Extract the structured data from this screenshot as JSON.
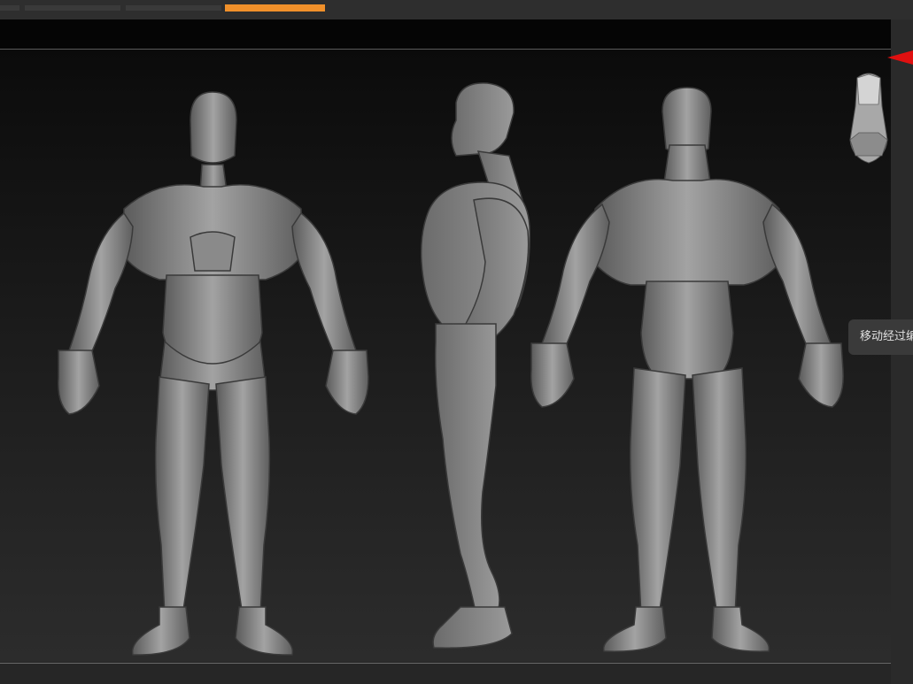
{
  "tooltip": {
    "text": "移动经过编"
  },
  "toolbar": {
    "active_color": "#f0902a"
  },
  "viewport": {
    "model_color": "#8a8a8a",
    "views": [
      "front",
      "side",
      "back"
    ]
  },
  "icons": {
    "navigation_arrow": "arrow-icon",
    "navigation_cube": "head-cube-icon"
  }
}
